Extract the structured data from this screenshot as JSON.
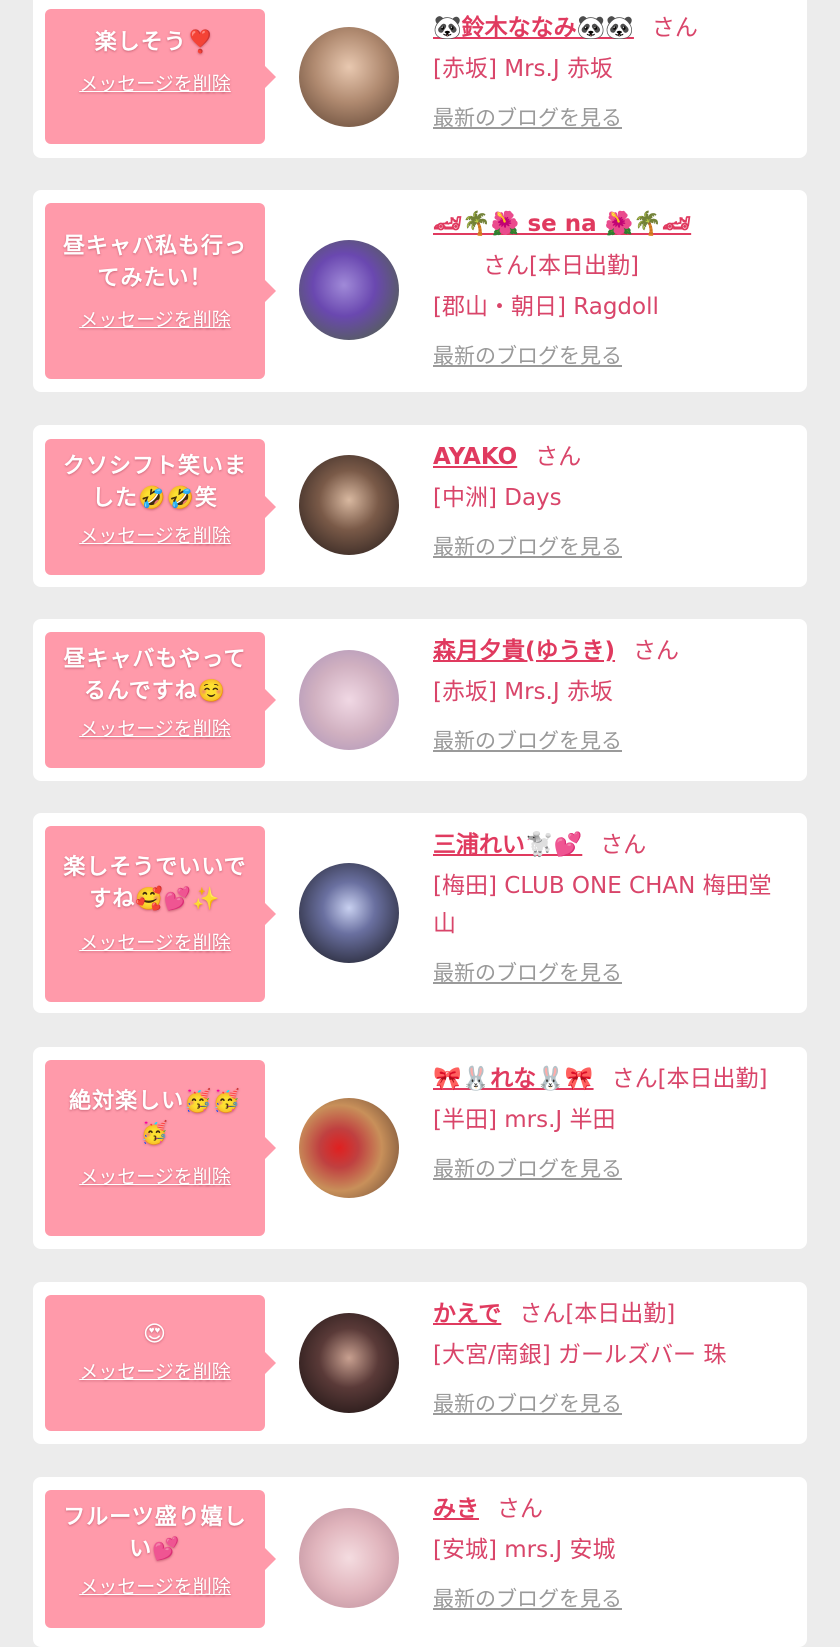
{
  "cards": [
    {
      "message": "楽しそう❣️",
      "delete_label": "メッセージを削除",
      "name": "🐼鈴木ななみ🐼🐼",
      "honorific": "さん",
      "shop": "[赤坂] Mrs.J 赤坂",
      "blog_label": "最新のブログを見る",
      "avatar_color": "#b08a70"
    },
    {
      "message": "昼キャバ私も行ってみたい！",
      "delete_label": "メッセージを削除",
      "name": "🏎🌴🌺 se na 🌺🌴🏎",
      "honorific": "さん[本日出勤]",
      "shop": "[郡山・朝日] Ragdoll",
      "blog_label": "最新のブログを見る",
      "avatar_color": "#7a55b8"
    },
    {
      "message": "クソシフト笑いました🤣🤣笑",
      "delete_label": "メッセージを削除",
      "name": "AYAKO",
      "honorific": "さん",
      "shop": "[中洲] Days",
      "blog_label": "最新のブログを見る",
      "avatar_color": "#4a3a30"
    },
    {
      "message": "昼キャバもやってるんですね☺️",
      "delete_label": "メッセージを削除",
      "name": "森月夕貴(ゆうき)",
      "honorific": "さん",
      "shop": "[赤坂] Mrs.J 赤坂",
      "blog_label": "最新のブログを見る",
      "avatar_color": "#d8c0cc"
    },
    {
      "message": "楽しそうでいいですね🥰💕✨",
      "delete_label": "メッセージを削除",
      "name": "三浦れい🐩💕",
      "honorific": "さん",
      "shop": "[梅田] CLUB ONE CHAN 梅田堂山",
      "blog_label": "最新のブログを見る",
      "avatar_color": "#2a2a35"
    },
    {
      "message": "絶対楽しい🥳🥳🥳",
      "delete_label": "メッセージを削除",
      "name": "🎀🐰れな🐰🎀",
      "honorific": "さん[本日出勤]",
      "shop": "[半田] mrs.J 半田",
      "blog_label": "最新のブログを見る",
      "avatar_color": "#c8905a"
    },
    {
      "message": "😍",
      "delete_label": "メッセージを削除",
      "name": "かえで",
      "honorific": "さん[本日出勤]",
      "shop": "[大宮/南銀] ガールズバー 珠",
      "blog_label": "最新のブログを見る",
      "avatar_color": "#3a2a28"
    },
    {
      "message": "フルーツ盛り嬉しい💕",
      "delete_label": "メッセージを削除",
      "name": "みき",
      "honorific": "さん",
      "shop": "[安城] mrs.J 安城",
      "blog_label": "最新のブログを見る",
      "avatar_color": "#e0b4bc"
    }
  ]
}
